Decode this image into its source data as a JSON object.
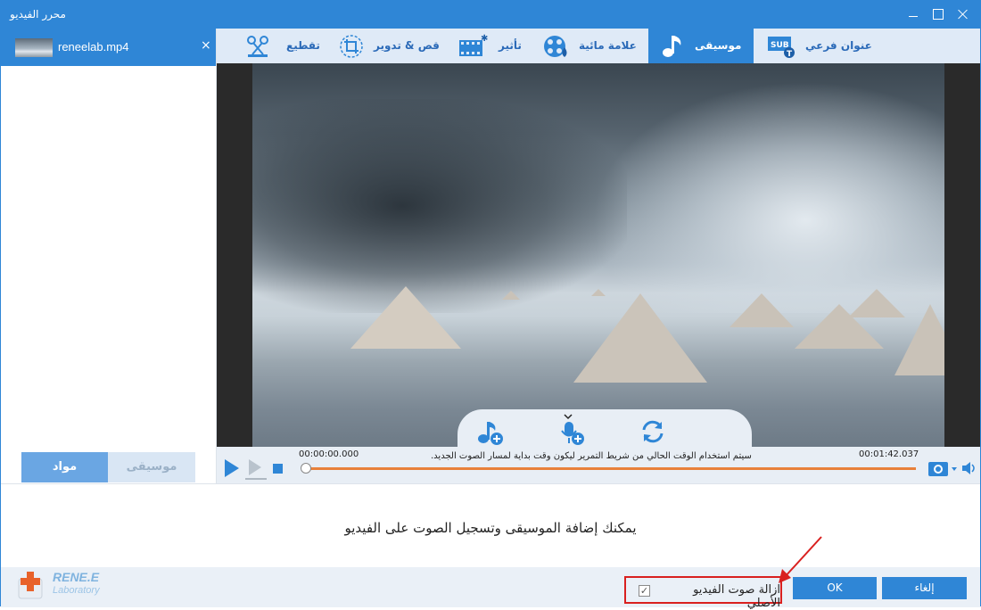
{
  "window": {
    "title": "محرر الفيديو"
  },
  "file": {
    "name": "reneelab.mp4",
    "close_symbol": "×"
  },
  "left_tabs": {
    "materials": "مواد",
    "music": "موسيقى"
  },
  "top_tabs": [
    {
      "id": "subtitle",
      "label": "عنوان فرعي"
    },
    {
      "id": "music",
      "label": "موسيقى"
    },
    {
      "id": "watermark",
      "label": "علامة مائية"
    },
    {
      "id": "effect",
      "label": "تأثير"
    },
    {
      "id": "crop",
      "label": "قص & تدوير"
    },
    {
      "id": "trim",
      "label": "تقطيع"
    }
  ],
  "player": {
    "time_start": "00:00:00.000",
    "time_end": "00:01:42.037",
    "hint": "سيتم استخدام الوقت الحالي من شريط التمرير ليكون وقت بداية لمسار الصوت الجديد.",
    "progress": 0.0
  },
  "description": "يمكنك إضافة الموسيقى وتسجيل الصوت على الفيديو",
  "footer": {
    "logo_line1": "RENE.E",
    "logo_line2": "Laboratory",
    "remove_audio_label": "ازالة صوت الفيديو الأصلي",
    "remove_audio_checked": true,
    "ok_label": "OK",
    "cancel_label": "إلغاء"
  },
  "colors": {
    "accent": "#2f86d6",
    "timeline": "#e8803a",
    "highlight": "#d9201f"
  }
}
